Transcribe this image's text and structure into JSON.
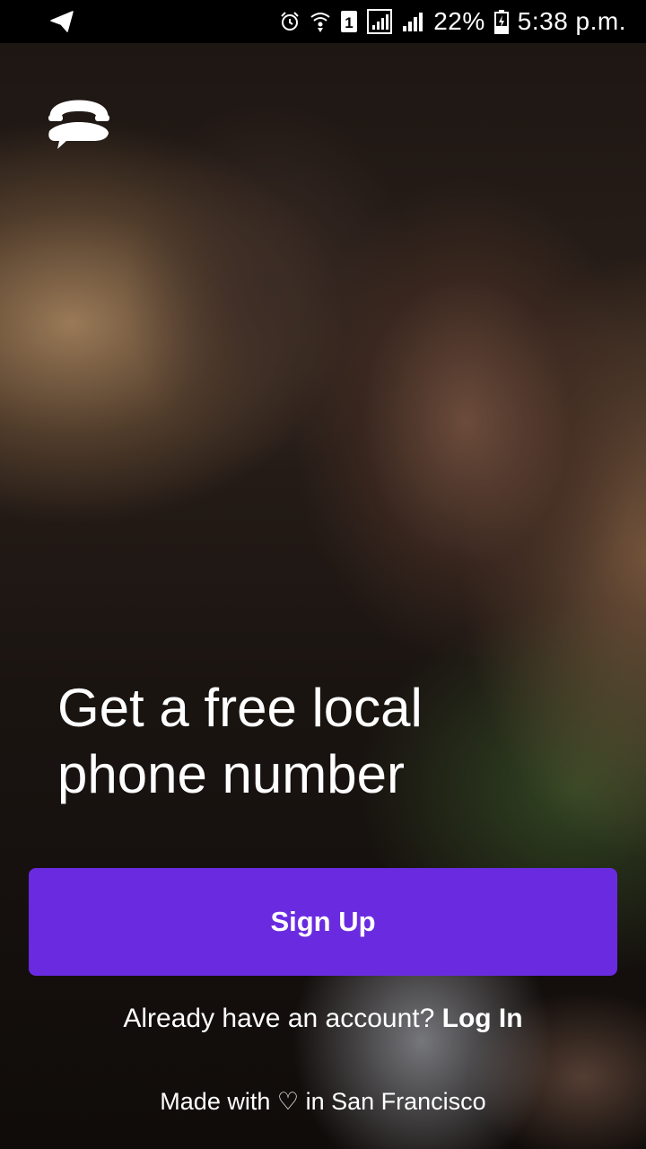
{
  "status_bar": {
    "left_icon": "telegram-send-icon",
    "icons": [
      "alarm-icon",
      "wifi-call-icon",
      "sim-1-icon",
      "signal-sim1-icon",
      "signal-sim2-icon",
      "battery-charging-icon"
    ],
    "battery": "22%",
    "time": "5:38 p.m."
  },
  "brand": {
    "logo_icon": "textnow-logo-icon"
  },
  "hero": {
    "headline": "Get a free local\nphone number"
  },
  "actions": {
    "signup_label": "Sign Up",
    "login_prompt": "Already have an account?",
    "login_label": "Log In"
  },
  "footer": {
    "made_with_prefix": "Made with",
    "heart": "♡",
    "made_with_suffix": "in San Francisco"
  },
  "colors": {
    "primary": "#6a2be0",
    "status_bar_bg": "#000000",
    "text": "#ffffff"
  }
}
